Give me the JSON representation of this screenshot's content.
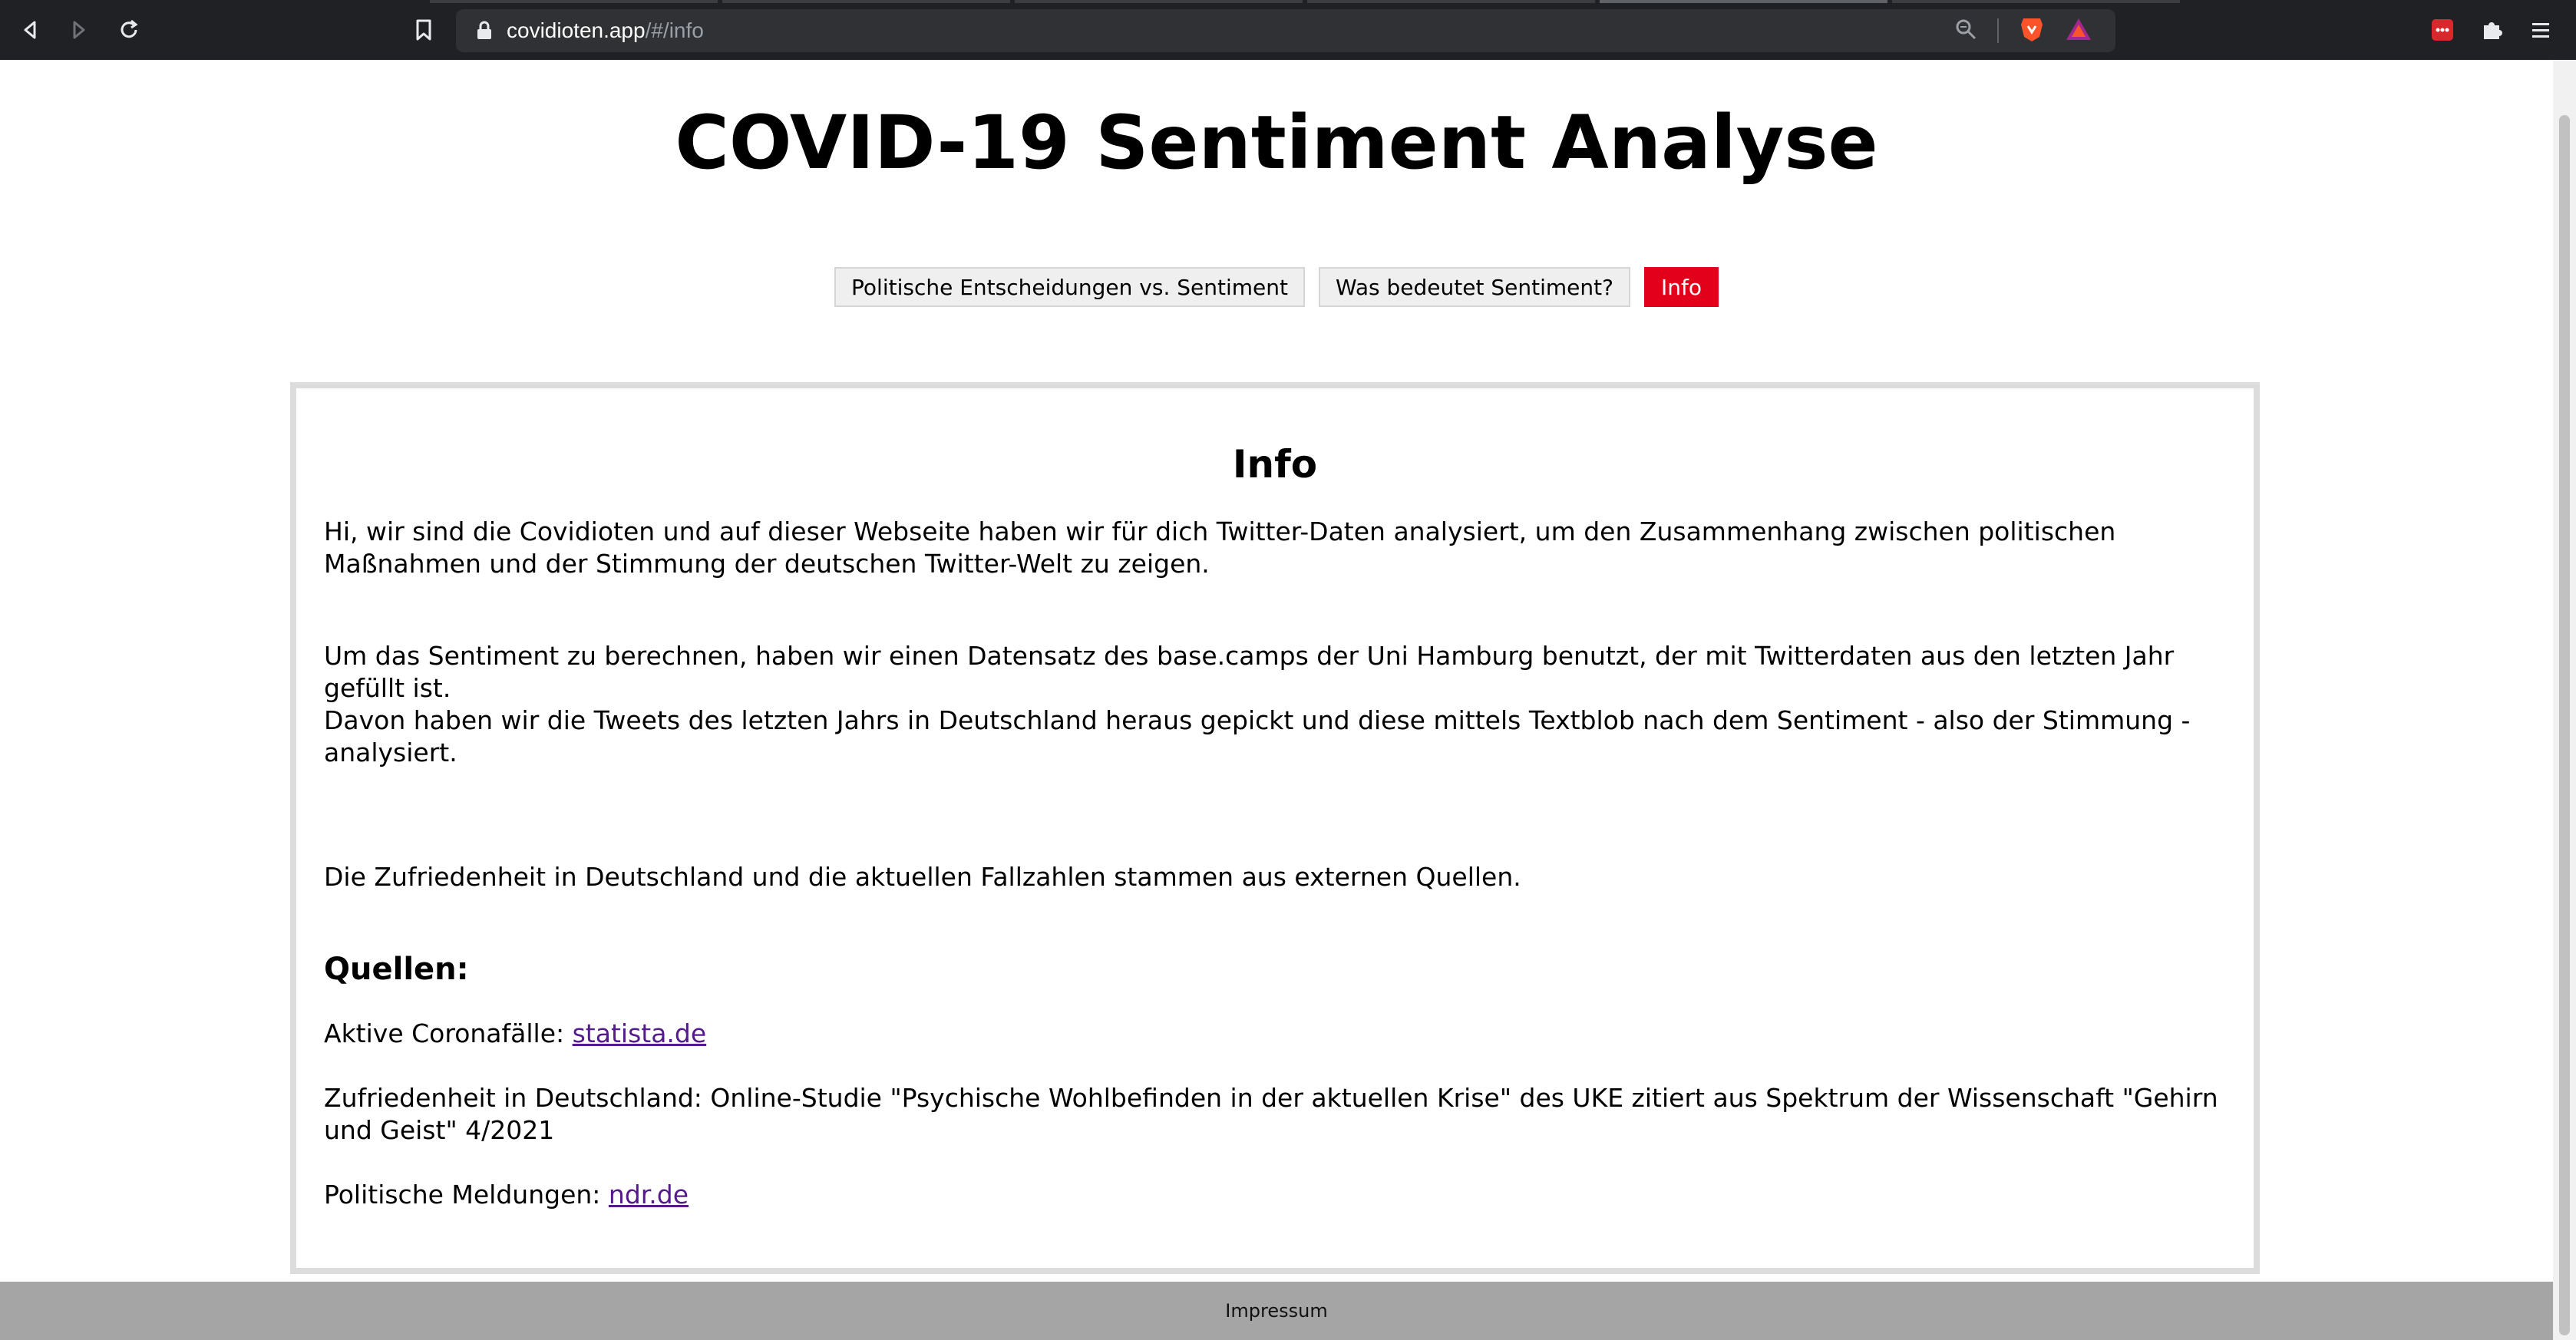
{
  "browser": {
    "url_host": "covidioten.app",
    "url_path": "/#/info",
    "icons": [
      "back-icon",
      "forward-icon",
      "reload-icon",
      "bookmark-icon",
      "lock-icon",
      "zoom-icon",
      "brave-shield-icon",
      "brave-rewards-icon",
      "extension-icon",
      "puzzle-icon",
      "menu-icon"
    ]
  },
  "page": {
    "title": "COVID-19 Sentiment Analyse",
    "nav": [
      {
        "label": "Politische Entscheidungen vs. Sentiment",
        "active": false
      },
      {
        "label": "Was bedeutet Sentiment?",
        "active": false
      },
      {
        "label": "Info",
        "active": true
      }
    ],
    "accent_color": "#e2001a"
  },
  "info": {
    "heading": "Info",
    "p1": "Hi, wir sind die Covidioten und auf dieser Webseite haben wir für dich Twitter-Daten analysiert, um den Zusammenhang zwischen politischen Maßnahmen und der Stimmung der deutschen Twitter-Welt zu zeigen.",
    "p2a": "Um das Sentiment zu berechnen, haben wir einen Datensatz des base.camps der Uni Hamburg benutzt, der mit Twitterdaten aus den letzten Jahr gefüllt ist.",
    "p2b": "Davon haben wir die Tweets des letzten Jahrs in Deutschland heraus gepickt und diese mittels Textblob nach dem Sentiment - also der Stimmung - analysiert.",
    "p3": "Die Zufriedenheit in Deutschland und die aktuellen Fallzahlen stammen aus externen Quellen.",
    "sources_heading": "Quellen:",
    "sources": [
      {
        "label": "Aktive Coronafälle: ",
        "link": "statista.de"
      },
      {
        "label": "Zufriedenheit in Deutschland: Online-Studie \"Psychische Wohlbefinden in der aktuellen Krise\" des UKE zitiert aus Spektrum der Wissenschaft \"Gehirn und Geist\" 4/2021",
        "link": ""
      },
      {
        "label": "Politische Meldungen: ",
        "link": "ndr.de"
      }
    ]
  },
  "footer": {
    "impressum": "Impressum"
  }
}
